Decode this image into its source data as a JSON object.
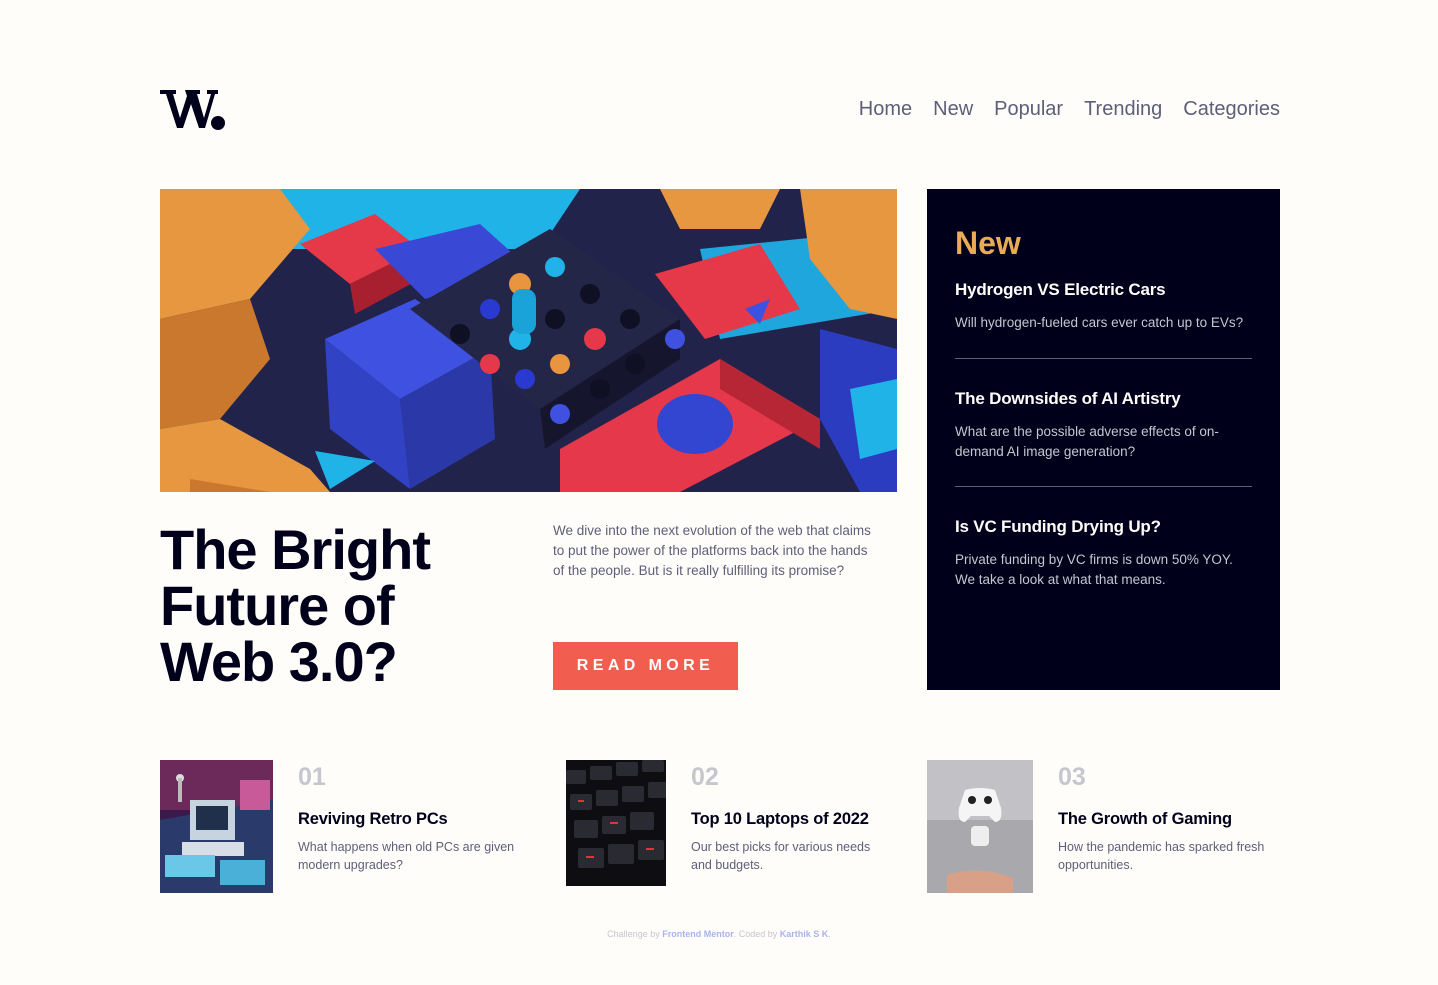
{
  "brand": {
    "logo_text": "W."
  },
  "nav": [
    {
      "label": "Home"
    },
    {
      "label": "New"
    },
    {
      "label": "Popular"
    },
    {
      "label": "Trending"
    },
    {
      "label": "Categories"
    }
  ],
  "hero": {
    "title": "The Bright Future of Web 3.0?",
    "description": "We dive into the next evolution of the web that claims to put the power of the platforms back into the hands of the people. But is it really fulfilling its promise?",
    "button_label": "READ MORE"
  },
  "new_panel": {
    "heading": "New",
    "items": [
      {
        "title": "Hydrogen VS Electric Cars",
        "text": "Will hydrogen-fueled cars ever catch up to EVs?"
      },
      {
        "title": "The Downsides of AI Artistry",
        "text": "What are the possible adverse effects of on-demand AI image generation?"
      },
      {
        "title": "Is VC Funding Drying Up?",
        "text": "Private funding by VC firms is down 50% YOY. We take a look at what that means."
      }
    ]
  },
  "articles": [
    {
      "number": "01",
      "title": "Reviving Retro PCs",
      "text": "What happens when old PCs are given modern upgrades?"
    },
    {
      "number": "02",
      "title": "Top 10 Laptops of 2022",
      "text": "Our best picks for various needs and budgets."
    },
    {
      "number": "03",
      "title": "The Growth of Gaming",
      "text": "How the pandemic has sparked fresh opportunities."
    }
  ],
  "footer": {
    "prefix": "Challenge by",
    "link1": "Frontend Mentor",
    "middle": ". Coded by",
    "link2": "Karthik S K",
    "suffix": "."
  },
  "colors": {
    "background": "#fffdfa",
    "dark": "#00001a",
    "accent_red": "#f15e50",
    "accent_orange": "#e9ab53",
    "muted": "#5d5f79",
    "light_muted": "#c5c6ce"
  }
}
